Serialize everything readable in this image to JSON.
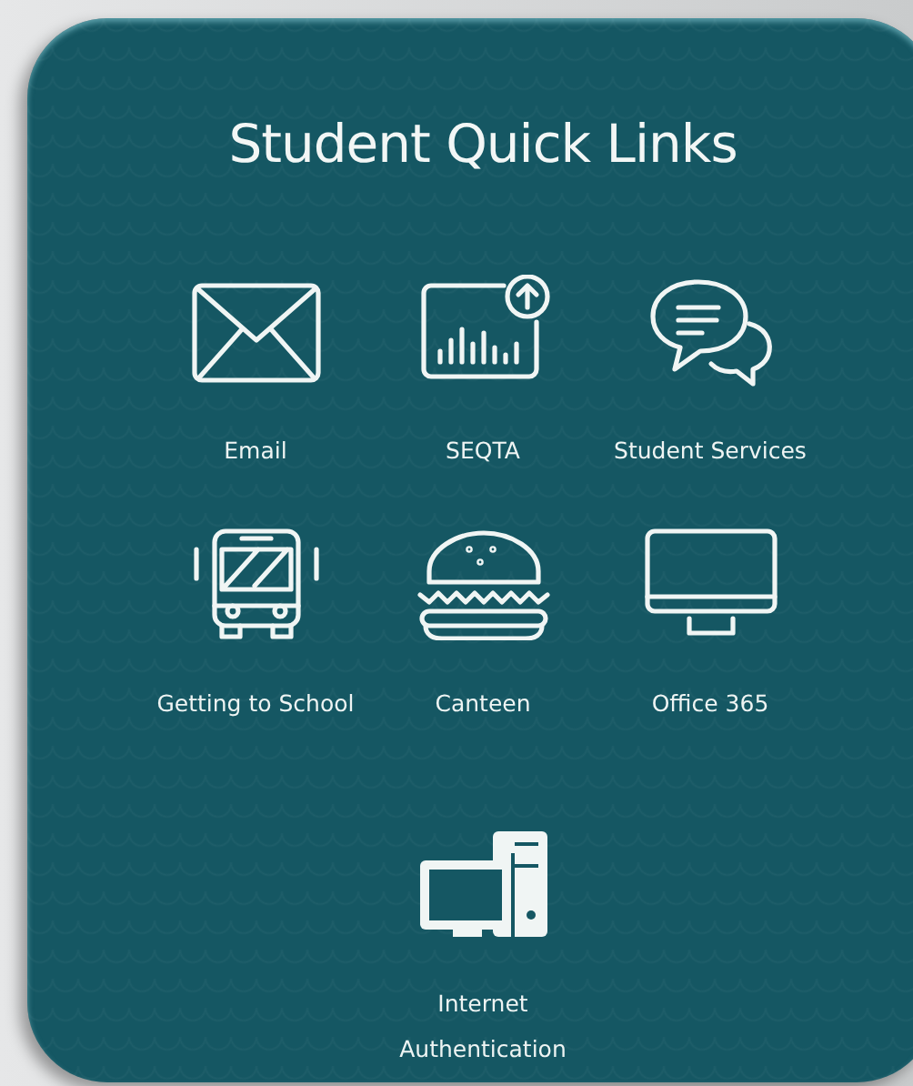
{
  "title": "Student Quick Links",
  "links": [
    {
      "label": "Email",
      "kind": "email"
    },
    {
      "label": "SEQTA",
      "kind": "chart"
    },
    {
      "label": "Student Services",
      "kind": "chat"
    },
    {
      "label": "Getting to School",
      "kind": "bus"
    },
    {
      "label": "Canteen",
      "kind": "burger"
    },
    {
      "label": "Office 365",
      "kind": "monitor"
    },
    {
      "label": "Internet Authentication",
      "kind": "computer"
    }
  ]
}
